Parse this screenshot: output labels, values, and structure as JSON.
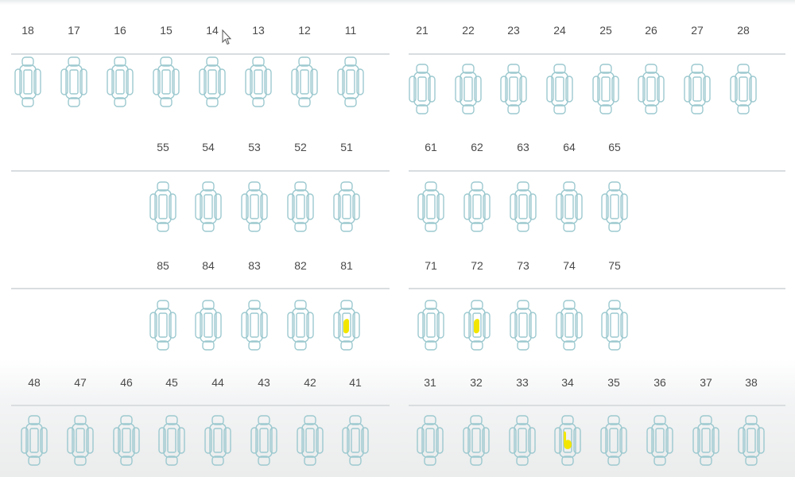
{
  "dental_chart": {
    "outline_color": "#9cc9cf",
    "mark_color": "#f2e600",
    "rows": [
      {
        "name": "permanent-upper",
        "left": [
          "18",
          "17",
          "16",
          "15",
          "14",
          "13",
          "12",
          "11"
        ],
        "right": [
          "21",
          "22",
          "23",
          "24",
          "25",
          "26",
          "27",
          "28"
        ]
      },
      {
        "name": "primary-upper",
        "left": [
          "55",
          "54",
          "53",
          "52",
          "51"
        ],
        "right": [
          "61",
          "62",
          "63",
          "64",
          "65"
        ]
      },
      {
        "name": "primary-lower",
        "left": [
          "85",
          "84",
          "83",
          "82",
          "81"
        ],
        "right": [
          "71",
          "72",
          "73",
          "74",
          "75"
        ]
      },
      {
        "name": "permanent-lower",
        "left": [
          "48",
          "47",
          "46",
          "45",
          "44",
          "43",
          "42",
          "41"
        ],
        "right": [
          "31",
          "32",
          "33",
          "34",
          "35",
          "36",
          "37",
          "38"
        ]
      }
    ],
    "marked_teeth": [
      {
        "tooth": "81",
        "mark": "filled-yellow"
      },
      {
        "tooth": "72",
        "mark": "filled-yellow"
      },
      {
        "tooth": "34",
        "mark": "filled-yellow"
      }
    ]
  }
}
